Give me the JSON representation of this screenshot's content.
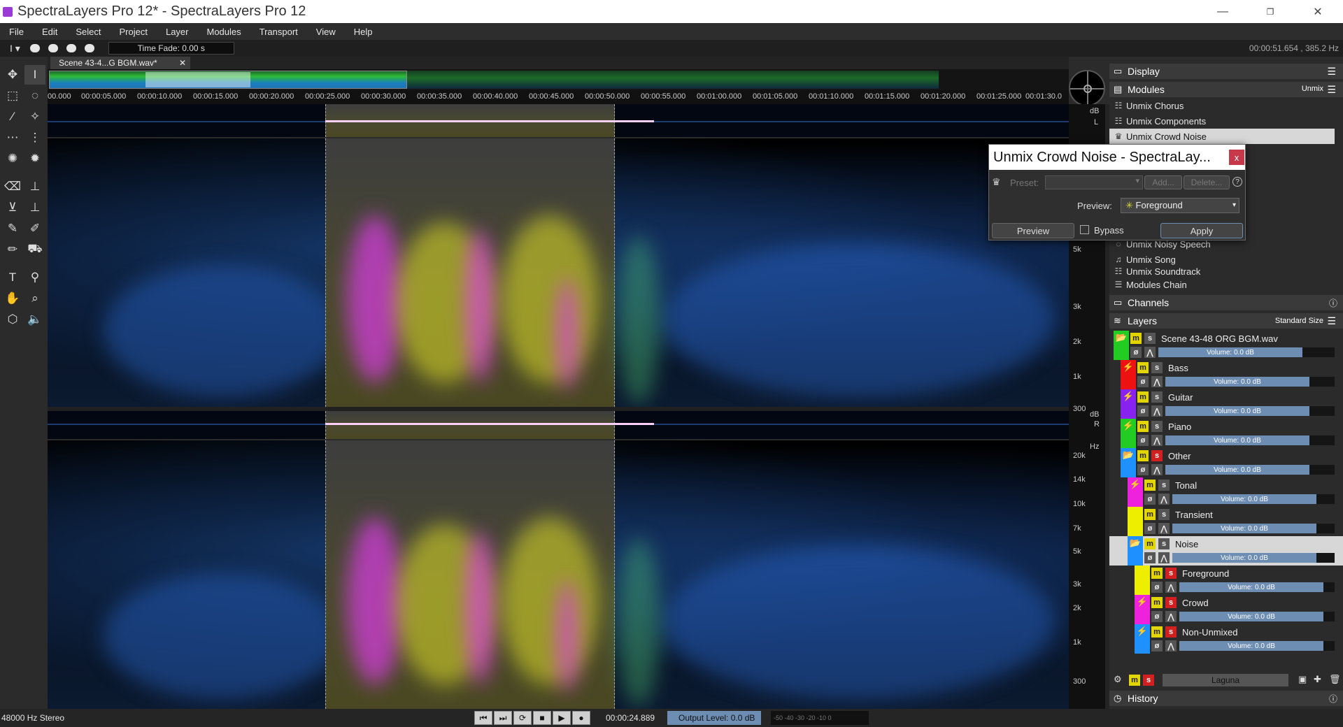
{
  "window": {
    "title": "SpectraLayers Pro 12* - SpectraLayers Pro 12",
    "minimize": "—",
    "maximize": "❐",
    "close": "✕"
  },
  "menu": [
    "File",
    "Edit",
    "Select",
    "Project",
    "Layer",
    "Modules",
    "Transport",
    "View",
    "Help"
  ],
  "toolbar": {
    "time_fade": "Time Fade: 0.00 s",
    "position_readout": "00:00:51.654 , 385.2 Hz"
  },
  "document": {
    "tab_label": "Scene 43-4...G BGM.wav*",
    "tab_close": "✕"
  },
  "ruler": {
    "ticks": [
      "00.000",
      "00:00:05.000",
      "00:00:10.000",
      "00:00:15.000",
      "00:00:20.000",
      "00:00:25.000",
      "00:00:30.000",
      "00:00:35.000",
      "00:00:40.000",
      "00:00:45.000",
      "00:00:50.000",
      "00:00:55.000",
      "00:01:00.000",
      "00:01:05.000",
      "00:01:10.000",
      "00:01:15.000",
      "00:01:20.000",
      "00:01:25.000",
      "00:01:30.0"
    ]
  },
  "scale": {
    "db": "dB",
    "left": "L",
    "right": "R",
    "hz": "Hz",
    "top_labels": [
      "5k",
      "3k",
      "2k",
      "1k",
      "300"
    ],
    "bottom_labels": [
      "20k",
      "14k",
      "10k",
      "7k",
      "5k",
      "3k",
      "2k",
      "1k",
      "300"
    ]
  },
  "panel": {
    "display": "Display",
    "modules": "Modules",
    "modules_filter": "Unmix",
    "module_items": [
      "Unmix Chorus",
      "Unmix Components",
      "Unmix Crowd Noise"
    ],
    "module_items_lower": [
      "Unmix Noisy Speech",
      "Unmix Song",
      "Unmix Soundtrack"
    ],
    "modules_chain": "Modules Chain",
    "channels": "Channels",
    "layers": "Layers",
    "layers_size": "Standard Size",
    "layers_list": [
      {
        "name": "Scene 43-48 ORG BGM.wav",
        "color": "#22cc22",
        "indent": 0,
        "solo_red": false,
        "volume": "Volume: 0.0 dB",
        "icon": "folder"
      },
      {
        "name": "Bass",
        "color": "#ee1111",
        "indent": 1,
        "solo_red": false,
        "volume": "Volume: 0.0 dB",
        "icon": "wave"
      },
      {
        "name": "Guitar",
        "color": "#8822ee",
        "indent": 1,
        "solo_red": false,
        "volume": "Volume: 0.0 dB",
        "icon": "wave"
      },
      {
        "name": "Piano",
        "color": "#22cc22",
        "indent": 1,
        "solo_red": false,
        "volume": "Volume: 0.0 dB",
        "icon": "wave"
      },
      {
        "name": "Other",
        "color": "#1e90ff",
        "indent": 1,
        "solo_red": true,
        "volume": "Volume: 0.0 dB",
        "icon": "folder"
      },
      {
        "name": "Tonal",
        "color": "#ee22dd",
        "indent": 2,
        "solo_red": false,
        "volume": "Volume: 0.0 dB",
        "icon": "wave"
      },
      {
        "name": "Transient",
        "color": "#eeee00",
        "indent": 2,
        "solo_red": false,
        "volume": "Volume: 0.0 dB",
        "icon": "none"
      },
      {
        "name": "Noise",
        "color": "#1e90ff",
        "indent": 2,
        "solo_red": false,
        "volume": "Volume: 0.0 dB",
        "icon": "folder",
        "selected": true
      },
      {
        "name": "Foreground",
        "color": "#eeee00",
        "indent": 3,
        "solo_red": true,
        "volume": "Volume: 0.0 dB",
        "icon": "none"
      },
      {
        "name": "Crowd",
        "color": "#ee22dd",
        "indent": 3,
        "solo_red": true,
        "volume": "Volume: 0.0 dB",
        "icon": "wave"
      },
      {
        "name": "Non-Unmixed",
        "color": "#1e90ff",
        "indent": 3,
        "solo_red": true,
        "volume": "Volume: 0.0 dB",
        "icon": "wave"
      }
    ],
    "mute_label": "m",
    "solo_label": "s",
    "phase_label": "ø",
    "env_label": "⋀",
    "laguna": "Laguna",
    "history": "History"
  },
  "dialog": {
    "title": "Unmix Crowd Noise - SpectraLay...",
    "close": "x",
    "preset_label": "Preset:",
    "add": "Add...",
    "delete": "Delete...",
    "help": "?",
    "preview_label": "Preview:",
    "preview_value": "Foreground",
    "preview_button": "Preview",
    "bypass": "Bypass",
    "apply": "Apply"
  },
  "status": {
    "format": "48000 Hz Stereo",
    "time": "00:00:24.889",
    "output_level": "Output Level: 0.0 dB",
    "meter": "-50 -40 -30 -20 -10 0"
  },
  "colors": {
    "accent": "#6d8db3",
    "mute": "#e3d500",
    "solo_active": "#d02020"
  }
}
